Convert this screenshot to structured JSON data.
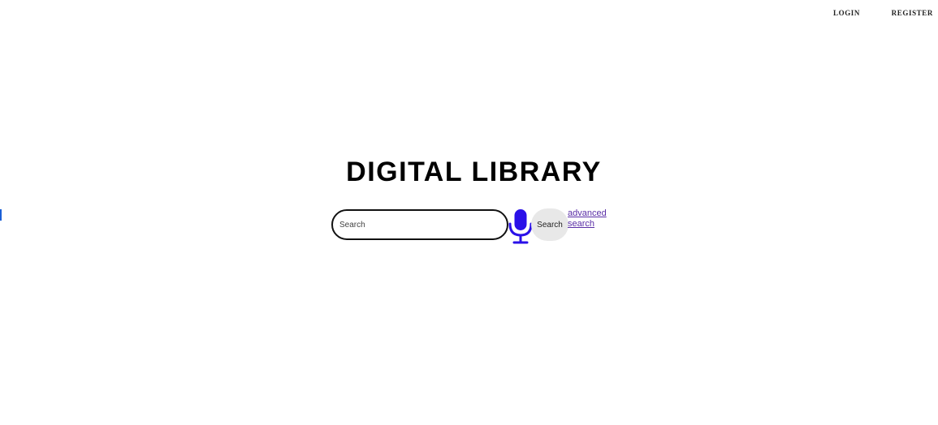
{
  "nav": {
    "login_label": "LOGIN",
    "register_label": "REGISTER"
  },
  "header": {
    "title": "DIGITAL LIBRARY"
  },
  "search": {
    "placeholder": "Search",
    "value": "",
    "button_label": "Search",
    "advanced_label": "advanced search",
    "mic_icon": "microphone-icon",
    "mic_color": "#2a10e8"
  },
  "colors": {
    "background": "#ffffff",
    "title": "#000000",
    "link": "#5a2ea6",
    "search_button_bg": "#e8e8e8",
    "focus_mark": "#1a5fd6"
  }
}
